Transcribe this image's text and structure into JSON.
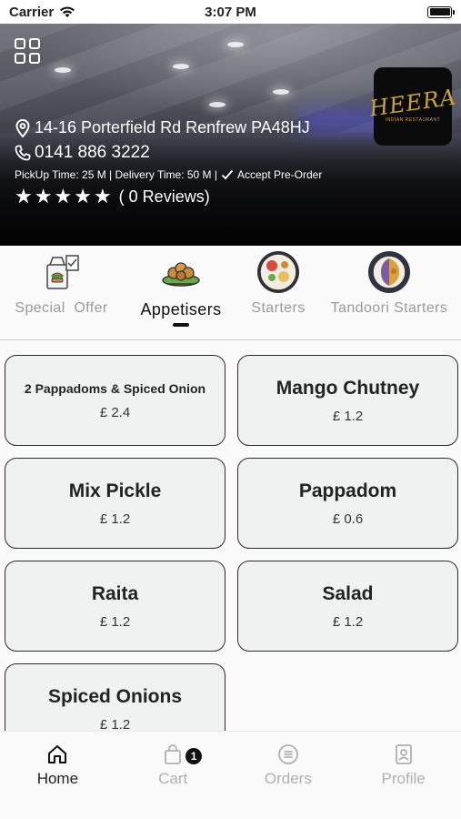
{
  "status_bar": {
    "carrier": "Carrier",
    "time": "3:07 PM"
  },
  "restaurant": {
    "logo_text": "HEERA",
    "logo_subtitle": "INDIAN RESTAURANT",
    "address": "14-16 Porterfield Rd Renfrew PA48HJ",
    "phone": "0141 886 3222",
    "times": "PickUp Time: 25 M | Delivery Time: 50 M |",
    "preorder": "Accept Pre-Order",
    "rating_stars": 5,
    "reviews": "( 0 Reviews)"
  },
  "categories": [
    {
      "label": "Special  Offer",
      "icon": "special-offer-icon",
      "active": false
    },
    {
      "label": "Appetisers",
      "icon": "appetisers-icon",
      "active": true
    },
    {
      "label": "Starters",
      "icon": "starters-icon",
      "active": false
    },
    {
      "label": "Tandoori Starters",
      "icon": "tandoori-icon",
      "active": false
    }
  ],
  "menu_items": [
    {
      "name": "2 Pappadoms & Spiced Onion",
      "price": "£ 2.4"
    },
    {
      "name": "Mango Chutney",
      "price": "£ 1.2"
    },
    {
      "name": "Mix Pickle",
      "price": "£ 1.2"
    },
    {
      "name": "Pappadom",
      "price": "£ 0.6"
    },
    {
      "name": "Raita",
      "price": "£ 1.2"
    },
    {
      "name": "Salad",
      "price": "£ 1.2"
    },
    {
      "name": "Spiced Onions",
      "price": "£ 1.2"
    }
  ],
  "bottom_nav": {
    "home": "Home",
    "cart": "Cart",
    "cart_badge": "1",
    "orders": "Orders",
    "profile": "Profile"
  },
  "colors": {
    "card_bg": "#eef3f1",
    "card_border": "#2b2b2b",
    "active_text": "#111111",
    "inactive_text": "#9a9a9a"
  }
}
